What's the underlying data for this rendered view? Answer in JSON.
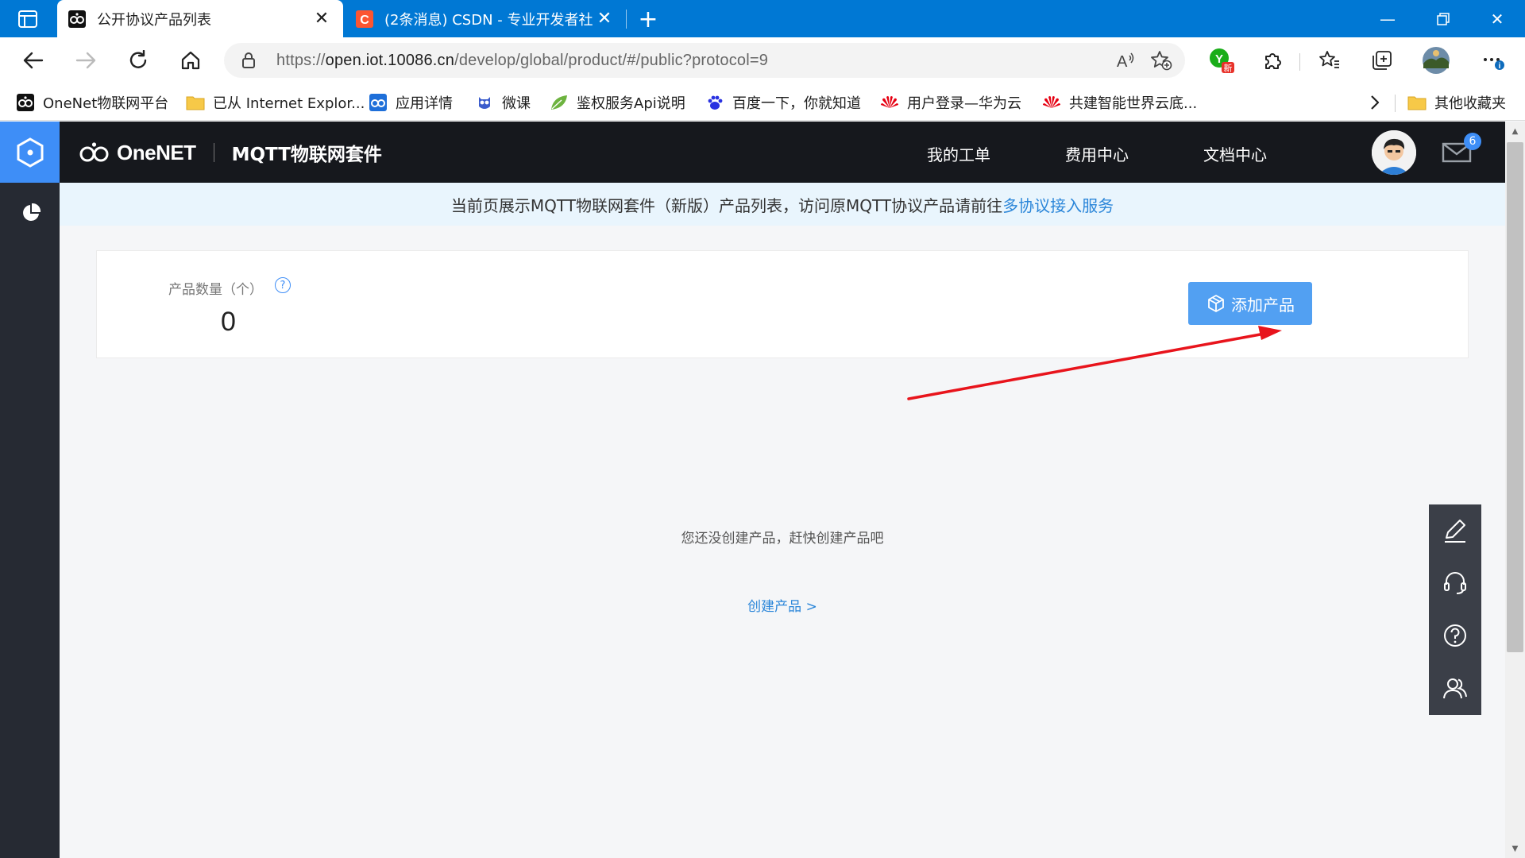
{
  "browser": {
    "tabs": [
      {
        "title": "公开协议产品列表",
        "active": true
      },
      {
        "title": "(2条消息) CSDN - 专业开发者社区",
        "active": false
      }
    ],
    "address": {
      "scheme": "https://",
      "host": "open.iot.10086.cn",
      "path": "/develop/global/product/#/public?protocol=9"
    },
    "profile_badge": "新",
    "bookmarks": [
      {
        "label": "OneNet物联网平台",
        "icon": "onenet-icon"
      },
      {
        "label": "已从 Internet Explor...",
        "icon": "folder-icon"
      },
      {
        "label": "应用详情",
        "icon": "onenet-icon"
      },
      {
        "label": "微课",
        "icon": "owl-icon"
      },
      {
        "label": "鉴权服务Api说明",
        "icon": "leaf-icon"
      },
      {
        "label": "百度一下，你就知道",
        "icon": "baidu-paw-icon"
      },
      {
        "label": "用户登录—华为云",
        "icon": "huawei-icon"
      },
      {
        "label": "共建智能世界云底...",
        "icon": "huawei-icon"
      }
    ],
    "other_bookmarks": "其他收藏夹"
  },
  "header": {
    "brand": "OneNET",
    "suite": "MQTT物联网套件",
    "nav": [
      "我的工单",
      "费用中心",
      "文档中心"
    ],
    "mail_count": "6"
  },
  "notice": {
    "text": "当前页展示MQTT物联网套件（新版）产品列表，访问原MQTT协议产品请前往 ",
    "link": "多协议接入服务"
  },
  "summary": {
    "count_label": "产品数量（个）",
    "help": "?",
    "count_value": "0",
    "add_button": "添加产品"
  },
  "empty": {
    "message": "您还没创建产品，赶快创建产品吧",
    "create_link": "创建产品 >"
  },
  "colors": {
    "tabbar": "#0078d4",
    "accent": "#3e8ef7",
    "add_button": "#52a0f2",
    "link": "#2b86d9",
    "annotation_arrow": "#e8141c"
  }
}
